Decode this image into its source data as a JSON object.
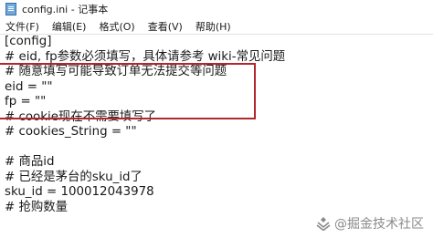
{
  "window": {
    "title": "config.ini - 记事本"
  },
  "menu": {
    "items": [
      {
        "label": "文件(F)"
      },
      {
        "label": "编辑(E)"
      },
      {
        "label": "格式(O)"
      },
      {
        "label": "查看(V)"
      },
      {
        "label": "帮助(H)"
      }
    ]
  },
  "editor": {
    "lines": [
      "[config]",
      "# eid, fp参数必须填写，具体请参考 wiki-常见问题",
      "# 随意填写可能导致订单无法提交等问题",
      "eid = \"\"",
      "fp = \"\"",
      "# cookie现在不需要填写了",
      "# cookies_String = \"\"",
      "",
      "# 商品id",
      "# 已经是茅台的sku_id了",
      "sku_id = 100012043978",
      "# 抢购数量"
    ]
  },
  "watermark": {
    "text": "@掘金技术社区"
  },
  "colors": {
    "highlight_border": "#b0282e",
    "watermark": "#8a8a8a"
  }
}
